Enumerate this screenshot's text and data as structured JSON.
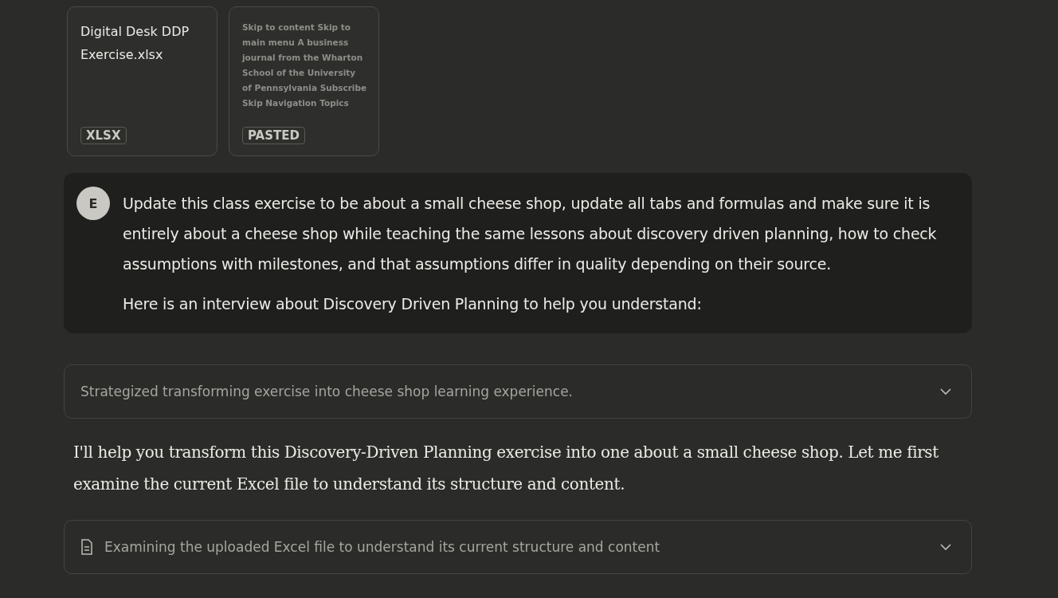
{
  "attachments": [
    {
      "kind": "file",
      "title": "Digital Desk DDP Exercise.xlsx",
      "badge": "XLSX"
    },
    {
      "kind": "pasted",
      "preview": "Skip to content Skip to main menu A business journal from the Wharton School of the University of Pennsylvania Subscribe Skip Navigation Topics",
      "badge": "PASTED"
    }
  ],
  "user_message": {
    "avatar": "E",
    "paragraphs": [
      "Update this class exercise to be about a small cheese shop, update all tabs and formulas and make sure it is entirely about a cheese shop while teaching the same lessons about discovery driven planning, how to check assumptions with milestones, and that assumptions differ in quality depending on their source.",
      "Here is an interview about Discovery Driven Planning to help you understand:"
    ]
  },
  "thinking": {
    "label": "Strategized transforming exercise into cheese shop learning experience.",
    "expanded": false
  },
  "response": "I'll help you transform this Discovery-Driven Planning exercise into one about a small cheese shop. Let me first examine the current Excel file to understand its structure and content.",
  "tool_step": {
    "label": "Examining the uploaded Excel file to understand its current structure and content",
    "expanded": false
  }
}
